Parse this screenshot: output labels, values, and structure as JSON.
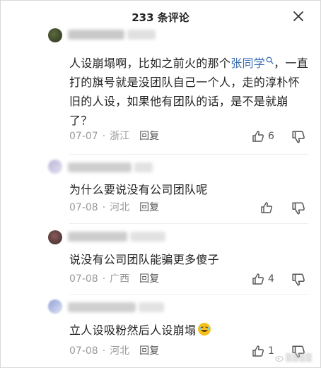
{
  "header": {
    "title": "233 条评论"
  },
  "comments": [
    {
      "text_before": "人设崩塌啊，比如之前火的那个",
      "link": "张同学",
      "text_after": "，一直打的旗号就是没团队自己一个人，走的淳朴怀旧的人设，如果他有团队的话，是不是就崩了？",
      "date": "07-07",
      "location": "浙江",
      "reply": "回复",
      "likes": "6"
    },
    {
      "text": "为什么要说没有公司团队呢",
      "date": "07-08",
      "location": "河北",
      "reply": "回复",
      "likes": ""
    },
    {
      "text": "说没有公司团队能骗更多傻子",
      "date": "07-08",
      "location": "广西",
      "reply": "回复",
      "likes": "4"
    },
    {
      "text": "立人设吸粉然后人设崩塌",
      "date": "07-08",
      "location": "河北",
      "reply": "回复",
      "likes": "1"
    }
  ],
  "colors": {
    "link": "#3b6fb3",
    "meta": "#9a9a9a",
    "emoji": "#f5c21b"
  },
  "icons": [
    "close-icon",
    "search-icon",
    "thumbs-up-icon",
    "thumbs-down-icon",
    "laughing-emoji-icon",
    "weibo-logo-icon"
  ]
}
